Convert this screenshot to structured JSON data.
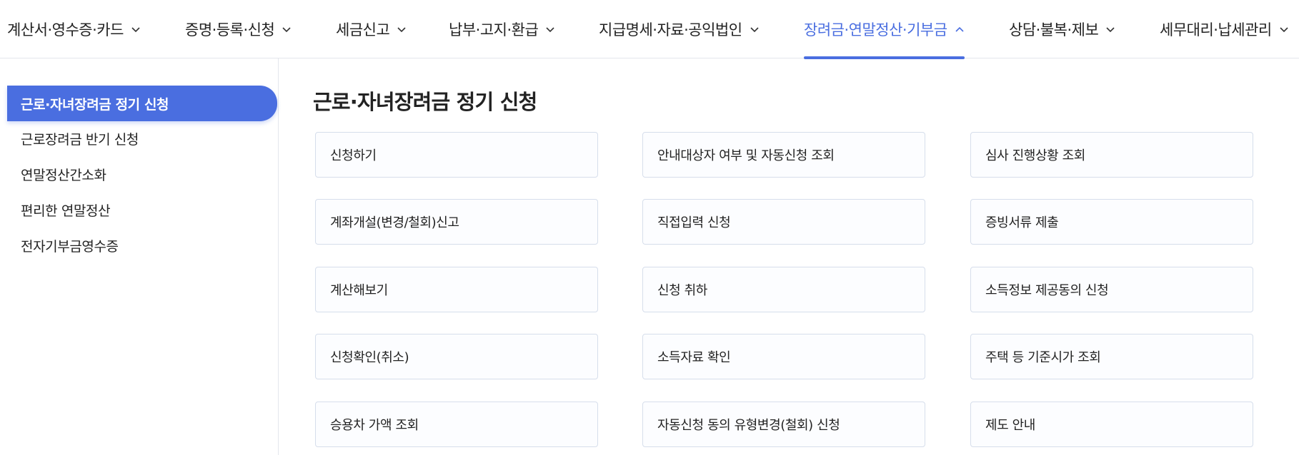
{
  "topnav": {
    "accent": "#4a6ee0",
    "items": [
      {
        "label": "계산서·영수증·카드",
        "icon": "chevron-down-icon"
      },
      {
        "label": "증명·등록·신청",
        "icon": "chevron-down-icon"
      },
      {
        "label": "세금신고",
        "icon": "chevron-down-icon"
      },
      {
        "label": "납부·고지·환급",
        "icon": "chevron-down-icon"
      },
      {
        "label": "지급명세·자료·공익법인",
        "icon": "chevron-down-icon"
      },
      {
        "label": "장려금·연말정산·기부금",
        "icon": "chevron-up-icon",
        "active": true
      },
      {
        "label": "상담·불복·제보",
        "icon": "chevron-down-icon"
      },
      {
        "label": "세무대리·납세관리",
        "icon": "chevron-down-icon"
      }
    ]
  },
  "sidebar": {
    "items": [
      {
        "label": "근로·자녀장려금 정기 신청",
        "active": true
      },
      {
        "label": "근로장려금 반기 신청"
      },
      {
        "label": "연말정산간소화"
      },
      {
        "label": "편리한 연말정산"
      },
      {
        "label": "전자기부금영수증"
      }
    ]
  },
  "main": {
    "title": "근로·자녀장려금 정기 신청",
    "cards": [
      "신청하기",
      "안내대상자 여부 및 자동신청 조회",
      "심사 진행상황 조회",
      "계좌개설(변경/철회)신고",
      "직접입력 신청",
      "증빙서류 제출",
      "계산해보기",
      "신청 취하",
      "소득정보 제공동의 신청",
      "신청확인(취소)",
      "소득자료 확인",
      "주택 등 기준시가 조회",
      "승용차 가액 조회",
      "자동신청 동의 유형변경(철회) 신청",
      "제도 안내"
    ]
  }
}
